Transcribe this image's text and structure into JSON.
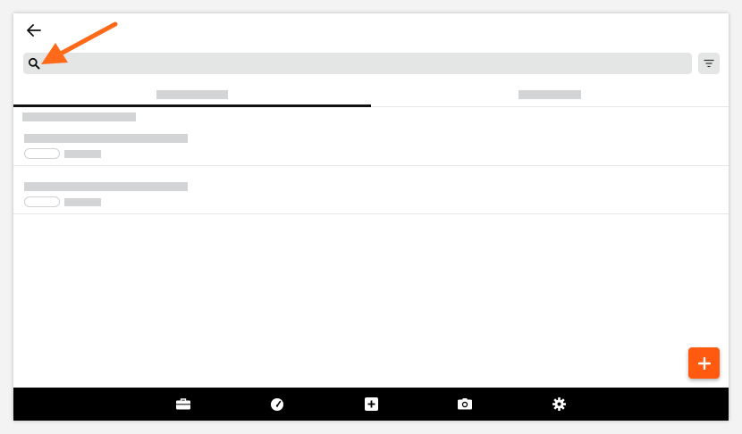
{
  "header": {
    "back_icon": "arrow-left-icon"
  },
  "search": {
    "placeholder": "",
    "value": "",
    "icon": "search-icon"
  },
  "filter": {
    "icon": "filter-icon"
  },
  "tabs": [
    {
      "label": "",
      "active": true
    },
    {
      "label": "",
      "active": false
    }
  ],
  "list": {
    "section_header": "",
    "items": [
      {
        "title": "",
        "badge": "",
        "meta": ""
      },
      {
        "title": "",
        "badge": "",
        "meta": ""
      }
    ]
  },
  "fab": {
    "icon": "plus-icon",
    "color": "#ff5a0f"
  },
  "bottom_nav": {
    "items": [
      {
        "icon": "briefcase-icon"
      },
      {
        "icon": "speedometer-icon"
      },
      {
        "icon": "plus-square-icon"
      },
      {
        "icon": "camera-icon"
      },
      {
        "icon": "gear-icon"
      }
    ]
  },
  "annotation": {
    "color": "#ff6a1a",
    "target": "search-icon"
  },
  "colors": {
    "background": "#ffffff",
    "search_bg": "#e4e6e6",
    "skeleton": "#d2d4d6",
    "nav_bg": "#000000",
    "accent": "#ff5a0f"
  }
}
